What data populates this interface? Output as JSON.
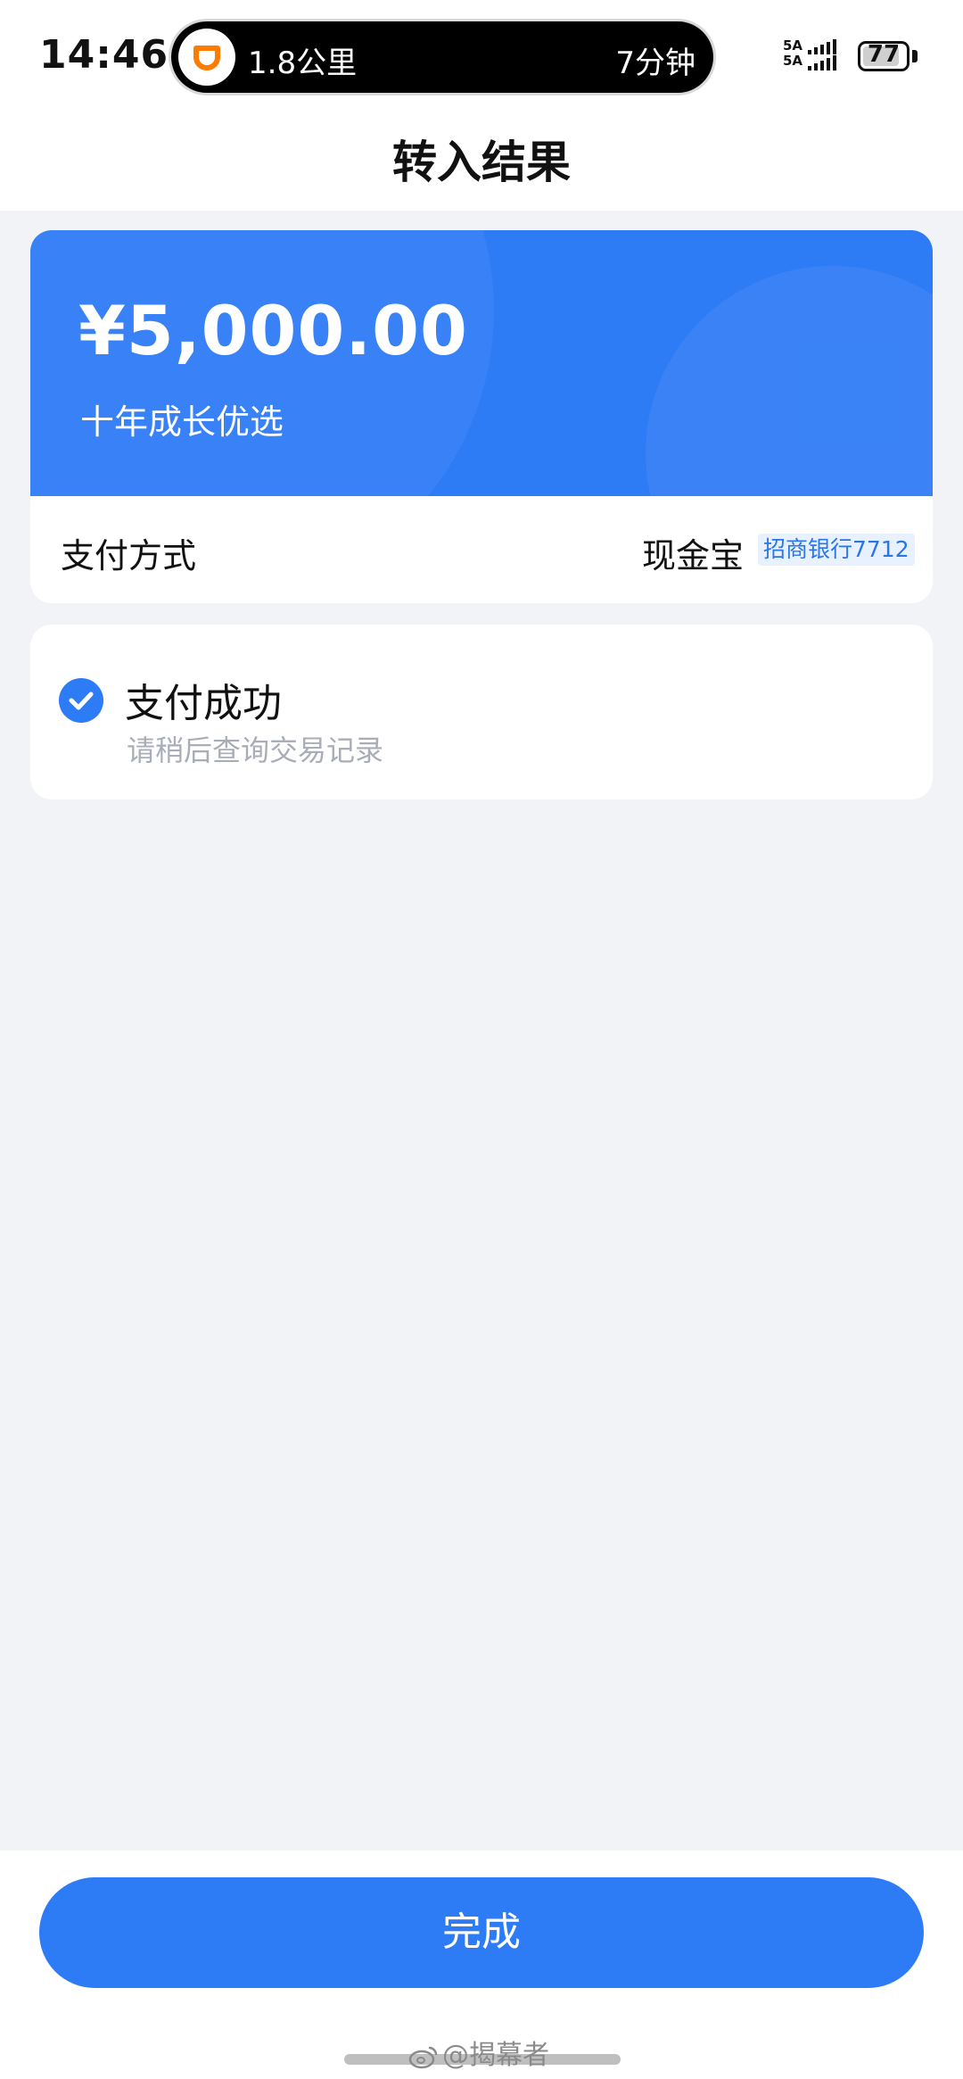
{
  "status_bar": {
    "time": "14:46",
    "ride": {
      "distance": "1.8公里",
      "eta": "7分钟",
      "app_icon": "didi-logo-icon"
    },
    "signal": {
      "top_label": "5A",
      "bottom_label": "5A",
      "icon": "cell-signal-icon"
    },
    "battery": {
      "level": "77",
      "icon": "battery-icon"
    }
  },
  "header": {
    "title": "转入结果"
  },
  "amount_card": {
    "amount": "¥5,000.00",
    "product": "十年成长优选",
    "payment_label": "支付方式",
    "payment_value": "现金宝",
    "bank_tag": "招商银行7712"
  },
  "status_card": {
    "title": "支付成功",
    "subtitle": "请稍后查询交易记录",
    "icon": "check-circle-icon"
  },
  "footer": {
    "done_label": "完成",
    "watermark": "@揭幕者"
  },
  "colors": {
    "accent": "#2e7bf6",
    "background": "#f2f3f7",
    "tag_bg": "#e8f1ff",
    "tag_text": "#2a76e8",
    "muted_text": "#a8adb8"
  }
}
